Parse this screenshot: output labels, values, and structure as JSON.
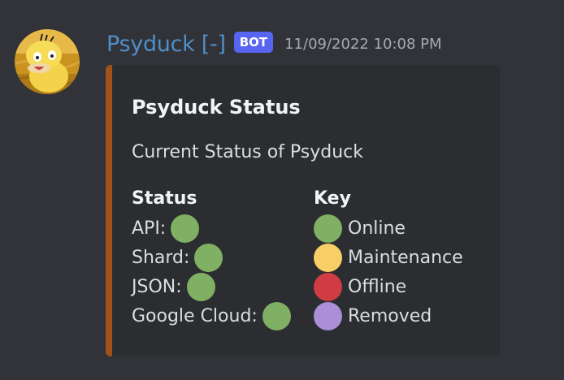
{
  "message": {
    "username": "Psyduck [-]",
    "bot_tag": "BOT",
    "timestamp": "11/09/2022 10:08 PM"
  },
  "embed": {
    "accent_color": "#a0521a",
    "title": "Psyduck Status",
    "description": "Current Status of Psyduck",
    "status_field": {
      "name": "Status",
      "items": [
        {
          "label": "API:",
          "state": "Online",
          "color": "#80b063"
        },
        {
          "label": "Shard:",
          "state": "Online",
          "color": "#80b063"
        },
        {
          "label": "JSON:",
          "state": "Online",
          "color": "#80b063"
        },
        {
          "label": "Google Cloud:",
          "state": "Online",
          "color": "#80b063"
        }
      ]
    },
    "key_field": {
      "name": "Key",
      "items": [
        {
          "label": "Online",
          "color": "#80b063"
        },
        {
          "label": "Maintenance",
          "color": "#f8ce67"
        },
        {
          "label": "Offline",
          "color": "#d03c44"
        },
        {
          "label": "Removed",
          "color": "#aa8ed6"
        }
      ]
    }
  }
}
